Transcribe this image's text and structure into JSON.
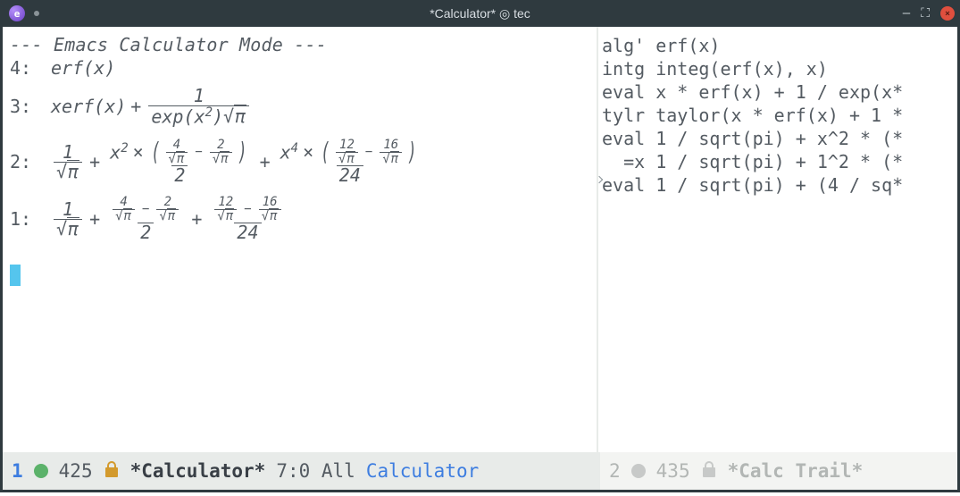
{
  "titlebar": {
    "title": "*Calculator* ◎ tec"
  },
  "calc": {
    "header": "--- Emacs Calculator Mode ---",
    "stack": {
      "r4": {
        "idx": "4:",
        "expr": "erf(x)"
      },
      "r3": {
        "idx": "3:",
        "lead": "xerf(x)",
        "plus": "+",
        "num": "1",
        "den_exp": "exp(x",
        "den_exp_sup": "2",
        "den_exp_close": ")",
        "pi": "π"
      },
      "r2": {
        "idx": "2:",
        "one": "1",
        "pi": "π",
        "x2": "x",
        "sup2": "2",
        "four": "4",
        "two": "2",
        "d2": "2",
        "x4": "x",
        "sup4": "4",
        "twelve": "12",
        "sixteen": "16",
        "d24": "24"
      },
      "r1": {
        "idx": "1:",
        "one": "1",
        "pi": "π",
        "four": "4",
        "two": "2",
        "d2": "2",
        "twelve": "12",
        "sixteen": "16",
        "d24": "24"
      }
    }
  },
  "trail": {
    "l1": "alg' erf(x)",
    "l2": "intg integ(erf(x), x)",
    "l3": "eval x * erf(x) + 1 / exp(x*",
    "l4": "tylr taylor(x * erf(x) + 1 *",
    "l5": "eval 1 / sqrt(pi) + x^2 * (*",
    "l6": "  =x 1 / sqrt(pi) + 1^2 * (*",
    "l7": "eval 1 / sqrt(pi) + (4 / sq*"
  },
  "modeline": {
    "active": {
      "winnum": "1",
      "line_count": "425",
      "buffer": "*Calculator*",
      "pos": "7:0 All",
      "mode": "Calculator"
    },
    "inactive": {
      "winnum": "2",
      "line_count": "435",
      "buffer": "*Calc Trail*"
    }
  }
}
